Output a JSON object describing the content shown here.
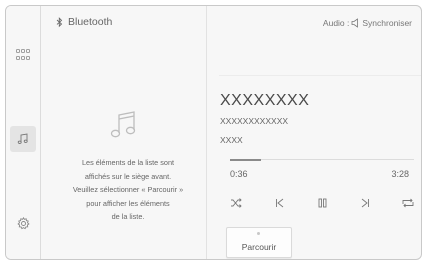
{
  "header": {
    "source_label": "Bluetooth",
    "audio_label": "Audio :",
    "sync_label": "Synchroniser"
  },
  "sidebar": {
    "items": [
      {
        "icon": "apps-grid-icon",
        "active": false
      },
      {
        "icon": "music-note-icon",
        "active": true
      },
      {
        "icon": "settings-gear-icon",
        "active": false
      }
    ]
  },
  "browse_panel": {
    "icon": "music-note-icon",
    "message_lines": [
      "Les éléments de la liste sont",
      "affichés sur le siège avant.",
      "Veuillez sélectionner « Parcourir »",
      "pour afficher les éléments",
      "de la liste."
    ]
  },
  "player": {
    "title": "XXXXXXXX",
    "artist": "XXXXXXXXXXXX",
    "album": "XXXX",
    "elapsed": "0:36",
    "duration": "3:28",
    "progress_fraction": 0.17,
    "controls": [
      "shuffle-icon",
      "previous-track-icon",
      "pause-icon",
      "next-track-icon",
      "repeat-icon"
    ],
    "browse_button_label": "Parcourir"
  }
}
